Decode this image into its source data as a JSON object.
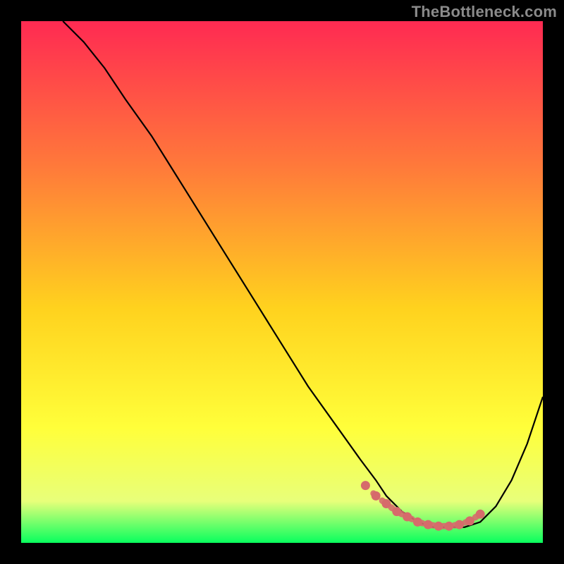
{
  "watermark": "TheBottleneck.com",
  "colors": {
    "background": "#000000",
    "curve": "#000000",
    "marker": "#d66b6b",
    "gradient_top": "#ff2a52",
    "gradient_mid1": "#ff7a3a",
    "gradient_mid2": "#ffd21e",
    "gradient_mid3": "#ffff3a",
    "gradient_mid4": "#e8ff7a",
    "gradient_bottom": "#08ff5e"
  },
  "chart_data": {
    "type": "line",
    "title": "",
    "xlabel": "",
    "ylabel": "",
    "xlim": [
      0,
      100
    ],
    "ylim": [
      0,
      100
    ],
    "note": "Axes are unlabeled; values are estimated as percentages of the plot area. The curve resembles a bottleneck profile: steep descent, a flat trough, then a rise.",
    "series": [
      {
        "name": "curve",
        "x": [
          8,
          12,
          16,
          20,
          25,
          30,
          35,
          40,
          45,
          50,
          55,
          60,
          65,
          68,
          70,
          73,
          76,
          79,
          82,
          85,
          88,
          91,
          94,
          97,
          100
        ],
        "y": [
          100,
          96,
          91,
          85,
          78,
          70,
          62,
          54,
          46,
          38,
          30,
          23,
          16,
          12,
          9,
          6,
          4,
          3,
          3,
          3,
          4,
          7,
          12,
          19,
          28
        ]
      }
    ],
    "markers": {
      "name": "trough-markers",
      "x": [
        66,
        68,
        70,
        72,
        74,
        76,
        78,
        80,
        82,
        84,
        86,
        88
      ],
      "y": [
        11,
        9,
        7.5,
        6,
        5,
        4,
        3.5,
        3.2,
        3.2,
        3.5,
        4.2,
        5.5
      ]
    }
  }
}
